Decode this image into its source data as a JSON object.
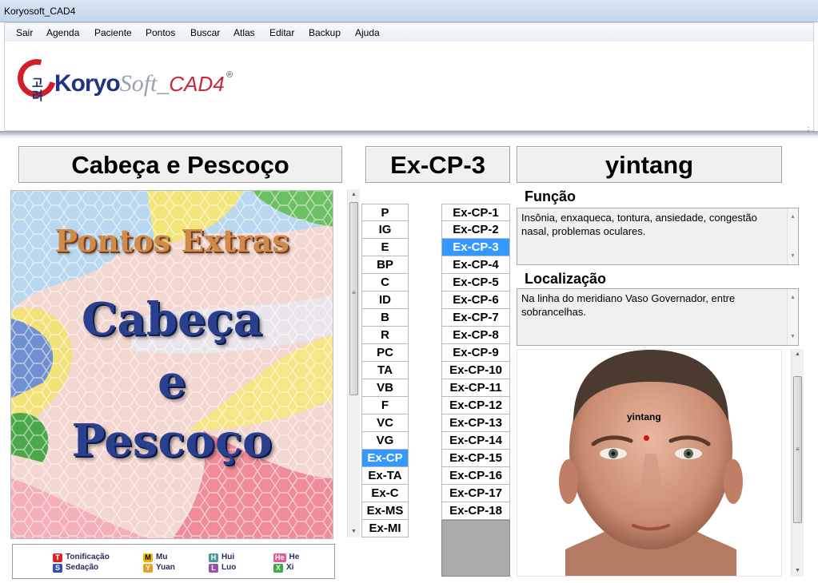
{
  "window": {
    "title": "Koryosoft_CAD4"
  },
  "menu": [
    "Sair",
    "Agenda",
    "Paciente",
    "Pontos",
    "Buscar",
    "Atlas",
    "Editar",
    "Backup",
    "Ajuda"
  ],
  "logo": {
    "hangul": "고려",
    "koryo": "Koryo",
    "soft": "Soft_",
    "cad": "CAD4",
    "registered": "®"
  },
  "headings": {
    "region": "Cabeça e Pescoço",
    "point_code": "Ex-CP-3",
    "point_name": "yintang"
  },
  "cover": {
    "line1": "Pontos Extras",
    "line2": "Cabeça",
    "line3": "e",
    "line4": "Pescoço"
  },
  "legend": [
    {
      "badge": "T",
      "label": "Tonificação",
      "color": "#d9232b"
    },
    {
      "badge": "S",
      "label": "Sedação",
      "color": "#2f4fa8"
    },
    {
      "badge": "M",
      "label": "Mu",
      "color": "#e8b500"
    },
    {
      "badge": "Y",
      "label": "Yuan",
      "color": "#e8a02c"
    },
    {
      "badge": "H",
      "label": "Hui",
      "color": "#4a9a9a"
    },
    {
      "badge": "L",
      "label": "Luo",
      "color": "#9a4fb0"
    },
    {
      "badge": "He",
      "label": "He",
      "color": "#e05a9a"
    },
    {
      "badge": "X",
      "label": "Xi",
      "color": "#3aa83a"
    }
  ],
  "meridians": [
    "P",
    "IG",
    "E",
    "BP",
    "C",
    "ID",
    "B",
    "R",
    "PC",
    "TA",
    "VB",
    "F",
    "VC",
    "VG",
    "Ex-CP",
    "Ex-TA",
    "Ex-C",
    "Ex-MS",
    "Ex-MI"
  ],
  "selected_meridian": "Ex-CP",
  "points": [
    "Ex-CP-1",
    "Ex-CP-2",
    "Ex-CP-3",
    "Ex-CP-4",
    "Ex-CP-5",
    "Ex-CP-6",
    "Ex-CP-7",
    "Ex-CP-8",
    "Ex-CP-9",
    "Ex-CP-10",
    "Ex-CP-11",
    "Ex-CP-12",
    "Ex-CP-13",
    "Ex-CP-14",
    "Ex-CP-15",
    "Ex-CP-16",
    "Ex-CP-17",
    "Ex-CP-18"
  ],
  "selected_point": "Ex-CP-3",
  "funcao": {
    "label": "Função",
    "text": "Insônia, enxaqueca, tontura, ansiedade, congestão nasal, problemas oculares."
  },
  "localizacao": {
    "label": "Localização",
    "text": "Na linha do meridiano Vaso Governador, entre sobrancelhas."
  },
  "figure": {
    "point_label": "yintang"
  }
}
